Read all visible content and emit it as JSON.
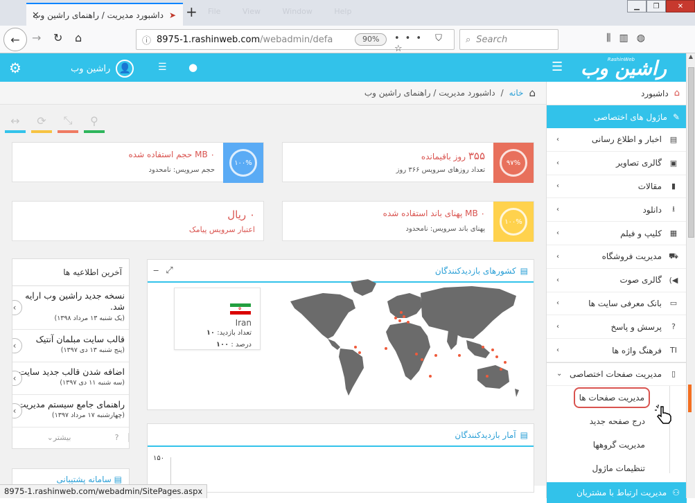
{
  "browser": {
    "tab_title": "داشبورد مدیریت / راهنمای راشین وب",
    "ghost_menu": "File  View  Window  Help",
    "url_host": "8975-1.rashinweb.com",
    "url_path": "/webadmin/defa",
    "zoom": "90%",
    "search_placeholder": "Search",
    "status_url": "8975-1.rashinweb.com/webadmin/SitePages.aspx"
  },
  "header": {
    "logo_text": "راشین وب",
    "logo_small": "RashinWeb",
    "user_name": "راشین وب"
  },
  "breadcrumb": {
    "home": "خانه",
    "separator": "/",
    "current": "داشبورد مدیریت / راهنمای راشین وب"
  },
  "toolstrip": {
    "colors": [
      "#33c3ea",
      "#f6c342",
      "#ef7b62",
      "#2eb55c"
    ]
  },
  "cards": {
    "days": {
      "value": "۳۵۵",
      "label": "روز باقیمانده",
      "sub": "تعداد روزهای سرویس ۳۶۶ روز",
      "percent": "۹۷%",
      "color": "#e8705c"
    },
    "storage": {
      "value": "۰ MB",
      "label": "حجم استفاده شده",
      "sub": "حجم سرویس: نامحدود",
      "percent": "۱۰۰%",
      "color": "#5aabf5"
    },
    "bandwidth": {
      "value": "۰ MB",
      "label": "پهنای باند استفاده شده",
      "sub": "پهنای باند سرویس: نامحدود",
      "percent": "۱۰۰%",
      "color": "#ffd24d"
    },
    "sms": {
      "value": "۰ ریال",
      "sub": "اعتبار سرویس پیامک"
    }
  },
  "news": {
    "title": "آخرین اطلاعیه ها",
    "items": [
      {
        "title": "نسخه جدید راشین وب ارایه شد.",
        "date": "(یک شنبه ۱۳ مرداد ۱۳۹۸)"
      },
      {
        "title": "قالب سایت مبلمان آنتیک",
        "date": "(پنج شنبه ۱۳ دی ۱۳۹۷)"
      },
      {
        "title": "اضافه شدن قالب جدید سایت",
        "date": "(سه شنبه ۱۱ دی ۱۳۹۷)"
      },
      {
        "title": "راهنمای جامع سیستم مدیریت",
        "date": "(چهارشنبه ۱۷ مرداد ۱۳۹۷)"
      }
    ],
    "more": "بیشتر",
    "help": "?"
  },
  "support": {
    "title": "سامانه پشتیبانی"
  },
  "map_panel": {
    "title": "کشورهای بازدیدکنندگان",
    "country": "Iran",
    "visits_label": "تعداد بازدید:",
    "visits": "۱۰",
    "percent_label": "درصد :",
    "percent": "۱۰۰"
  },
  "stats_panel": {
    "title": "آمار بازدیدکنندگان",
    "y_max": "۱۵۰"
  },
  "sidebar": {
    "dashboard": "داشبورد",
    "section": "ماژول های اختصاصی",
    "items": [
      {
        "label": "اخبار و اطلاع رسانی",
        "icon": "newspaper-icon"
      },
      {
        "label": "گالری تصاویر",
        "icon": "image-icon"
      },
      {
        "label": "مقالات",
        "icon": "document-icon"
      },
      {
        "label": "دانلود",
        "icon": "download-icon"
      },
      {
        "label": "کلیپ و فیلم",
        "icon": "film-icon"
      },
      {
        "label": "مدیریت فروشگاه",
        "icon": "cart-icon"
      },
      {
        "label": "گالری صوت",
        "icon": "volume-icon"
      },
      {
        "label": "بانک معرفی سایت ها",
        "icon": "monitor-icon"
      },
      {
        "label": "پرسش و پاسخ",
        "icon": "question-icon"
      },
      {
        "label": "فرهنگ واژه ها",
        "icon": "text-icon"
      }
    ],
    "expanded": {
      "label": "مدیریت صفحات اختصاصی",
      "icon": "file-icon"
    },
    "subitems": [
      "مدیریت صفحات ها",
      "درج صفحه جدید",
      "مدیریت گروهها",
      "تنظیمات ماژول"
    ],
    "bottom": "مدیریت ارتباط با مشتریان"
  }
}
